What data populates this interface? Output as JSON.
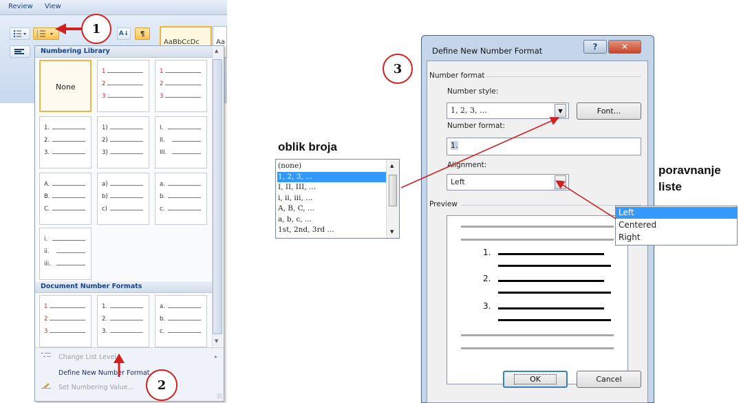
{
  "ribbon": {
    "tabs": [
      "Review",
      "View"
    ],
    "style_preview_1": "AaBbCcDc",
    "style_preview_2": "Aa"
  },
  "numbering_library": {
    "header": "Numbering Library",
    "none_label": "None",
    "doc_formats_header": "Document Number Formats",
    "grid_rows": [
      [
        [
          "",
          "",
          ""
        ],
        [
          "1",
          "2",
          "3"
        ],
        [
          "1",
          "2",
          "3"
        ]
      ],
      [
        [
          "1.",
          "2.",
          "3."
        ],
        [
          "1)",
          "2)",
          "3)"
        ],
        [
          "I.",
          "II.",
          "III."
        ]
      ],
      [
        [
          "A.",
          "B.",
          "C."
        ],
        [
          "a)",
          "b)",
          "c)"
        ],
        [
          "a.",
          "b.",
          "c."
        ]
      ],
      [
        [
          "i.",
          "ii.",
          "iii."
        ]
      ]
    ],
    "doc_row": [
      [
        "1",
        "2",
        "3"
      ],
      [
        "1.",
        "2.",
        "3."
      ],
      [
        "a.",
        "b.",
        "c."
      ]
    ],
    "menu": {
      "change_level": "Change List Level",
      "define_new": "Define New Number Format...",
      "set_value": "Set Numbering Value..."
    }
  },
  "steps": [
    "1",
    "2",
    "3"
  ],
  "oblik": {
    "title": "oblik broja",
    "items": [
      "(none)",
      "1, 2, 3, ...",
      "I, II, III, ...",
      "i, ii, iii, ...",
      "A, B, C, ...",
      "a, b, c, ...",
      "1st, 2nd, 3rd ..."
    ],
    "selected_index": 1
  },
  "dialog": {
    "title": "Define New Number Format",
    "group_label": "Number format",
    "number_style_label": "Number style:",
    "number_style_value": "1, 2, 3, ...",
    "font_button": "Font...",
    "number_format_label": "Number format:",
    "number_format_value": "1.",
    "alignment_label": "Alignment:",
    "alignment_value": "Left",
    "preview_label": "Preview",
    "preview_numbers": [
      "1.",
      "2.",
      "3."
    ],
    "ok": "OK",
    "cancel": "Cancel"
  },
  "poravnanje": {
    "title_line1": "poravnanje",
    "title_line2": "liste",
    "items": [
      "Left",
      "Centered",
      "Right"
    ],
    "selected_index": 0
  },
  "colors": {
    "annotation_red": "#d41f1f",
    "selection_blue": "#3399ff",
    "ribbon_active": "#ffc24d"
  }
}
